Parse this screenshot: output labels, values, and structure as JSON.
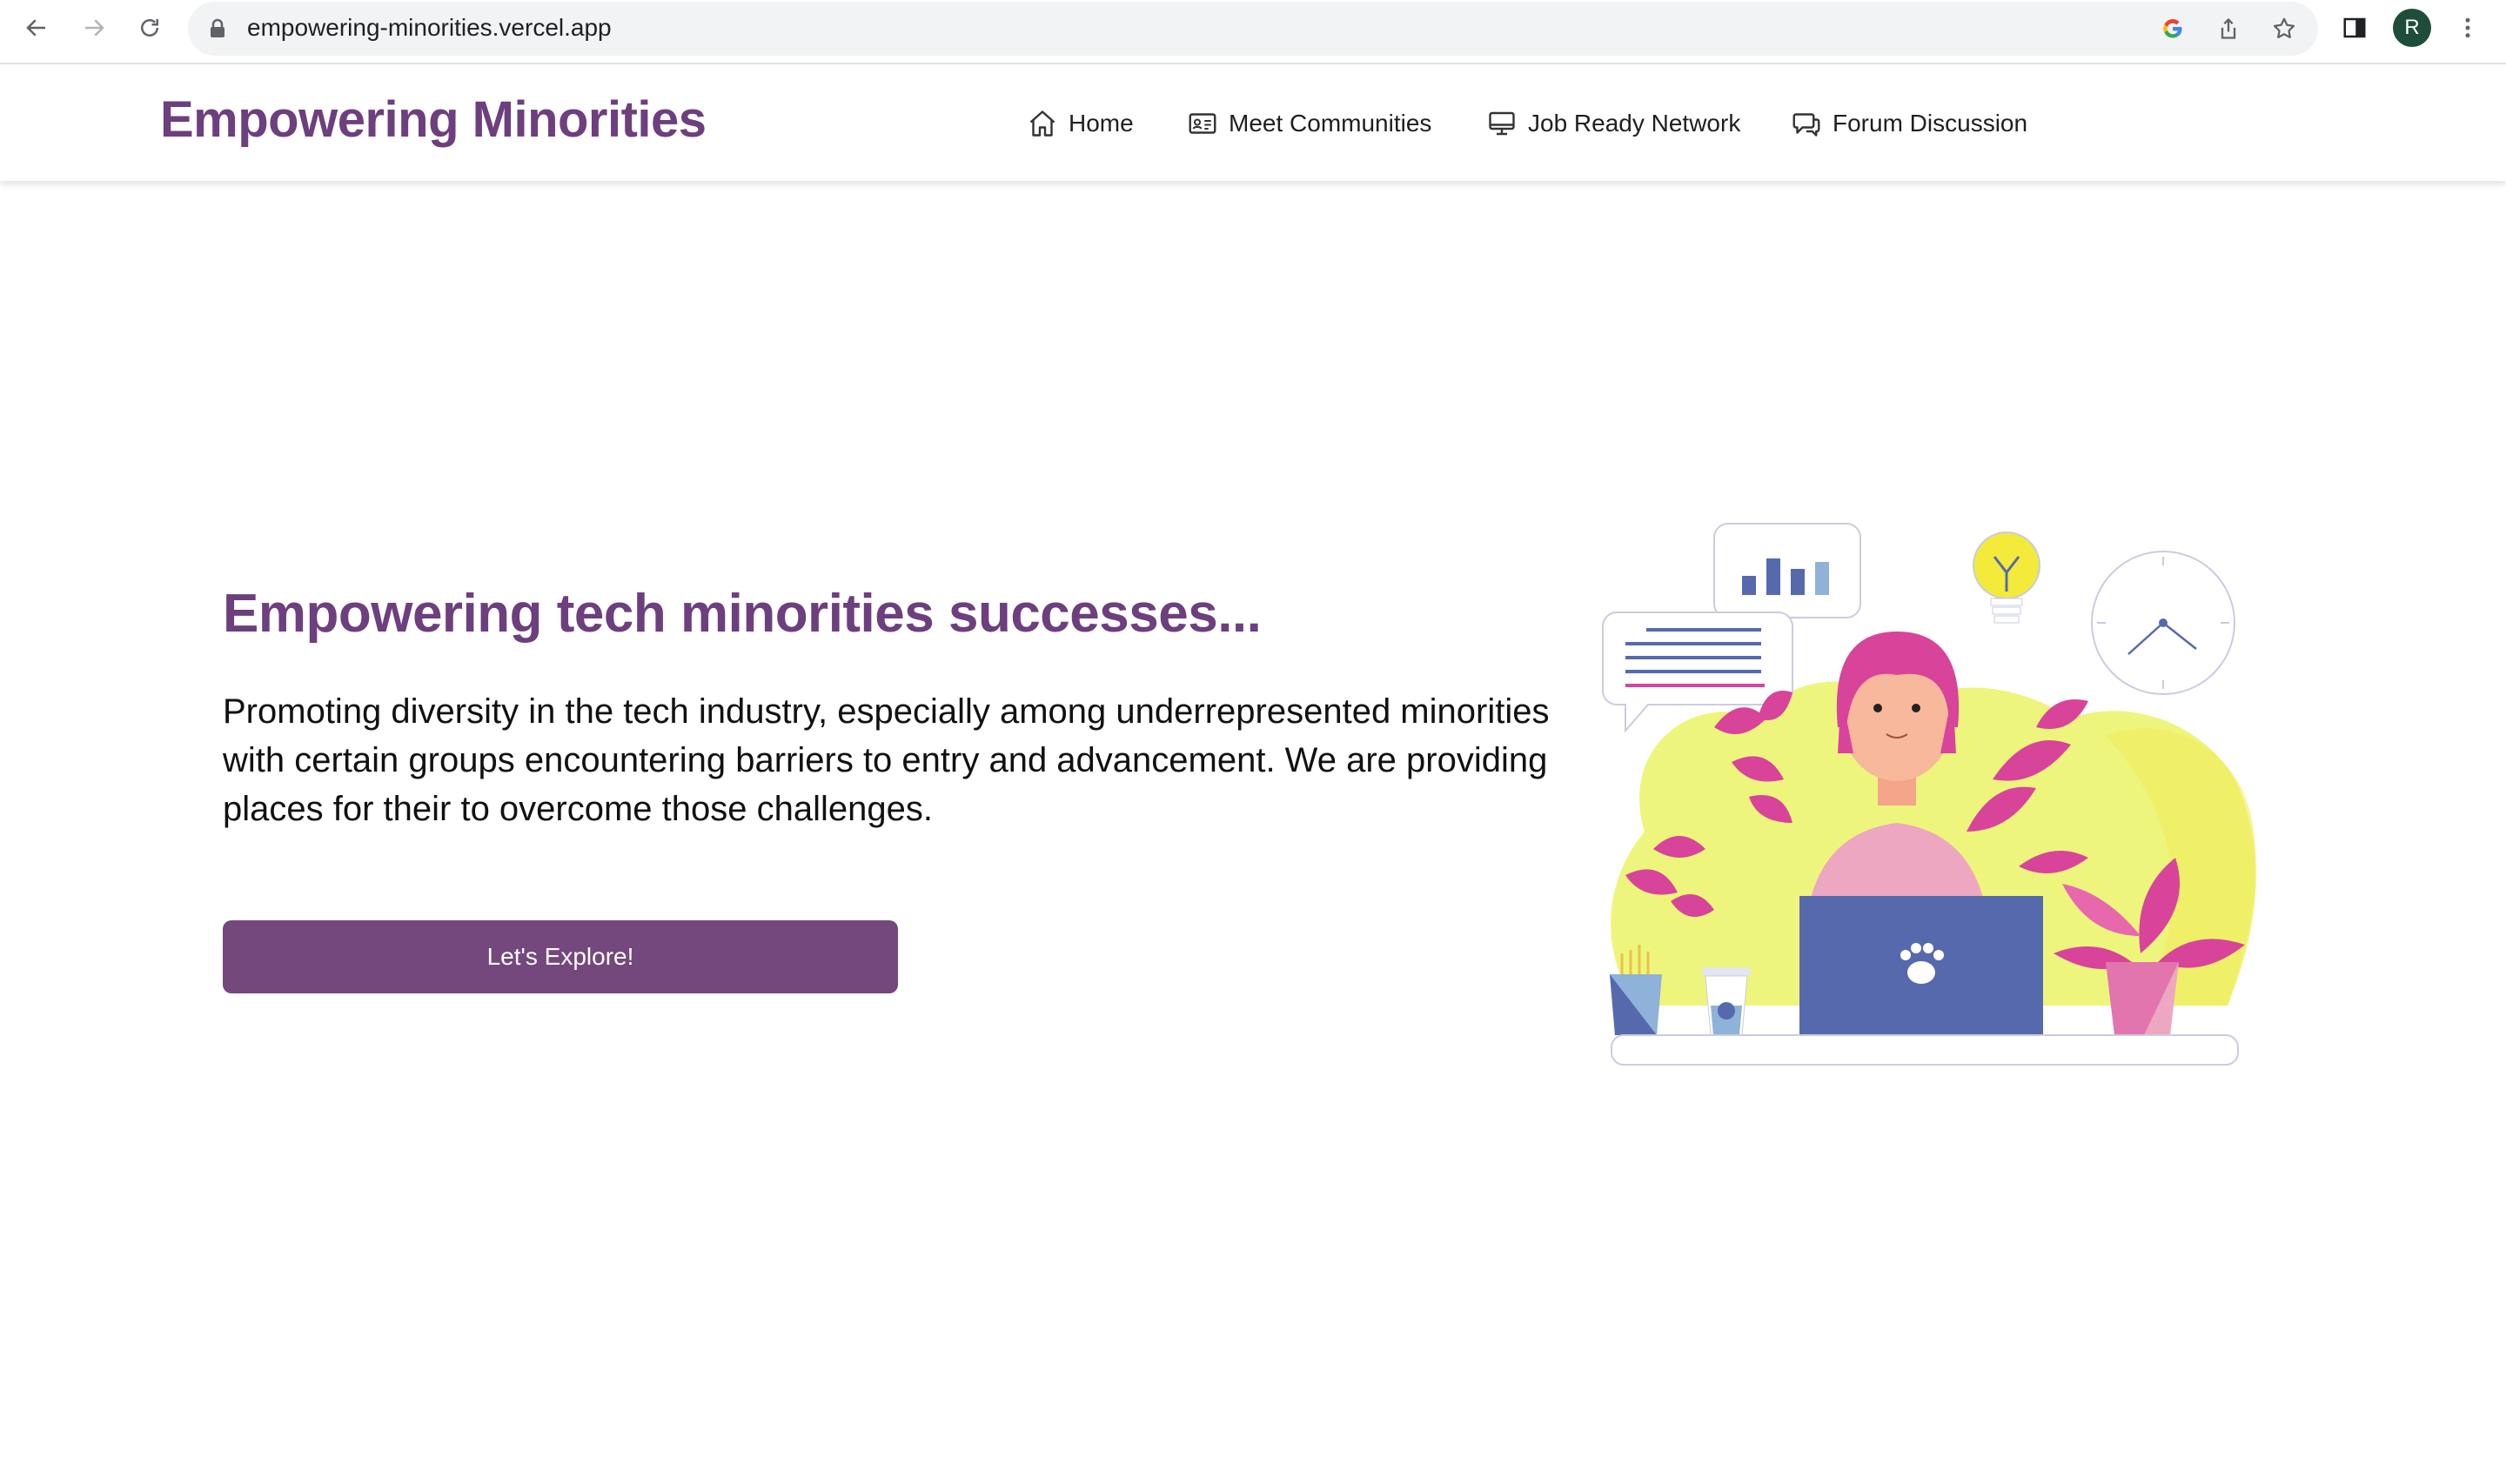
{
  "browser": {
    "url": "empowering-minorities.vercel.app",
    "profile_initial": "R",
    "icons": [
      "back-icon",
      "forward-icon",
      "reload-icon",
      "lock-icon",
      "google-icon",
      "share-icon",
      "star-icon",
      "side-panel-icon",
      "menu-icon"
    ]
  },
  "header": {
    "brand": "Empowering Minorities",
    "nav": [
      {
        "label": "Home",
        "icon": "home-icon"
      },
      {
        "label": "Meet Communities",
        "icon": "id-card-icon"
      },
      {
        "label": "Job Ready Network",
        "icon": "monitor-icon"
      },
      {
        "label": "Forum Discussion",
        "icon": "chat-icon"
      }
    ]
  },
  "hero": {
    "title": "Empowering tech minorities successes...",
    "description": "Promoting diversity in the tech industry, especially among underrepresented minorities with certain groups encountering barriers to entry and advancement. We are providing places for their to overcome those challenges.",
    "cta_label": "Let's Explore!"
  },
  "colors": {
    "brand": "#6d3f7e",
    "button": "#74487c",
    "illustration_yellow": "#eef57d",
    "illustration_pink": "#d8449a",
    "illustration_blue": "#5769ad"
  }
}
